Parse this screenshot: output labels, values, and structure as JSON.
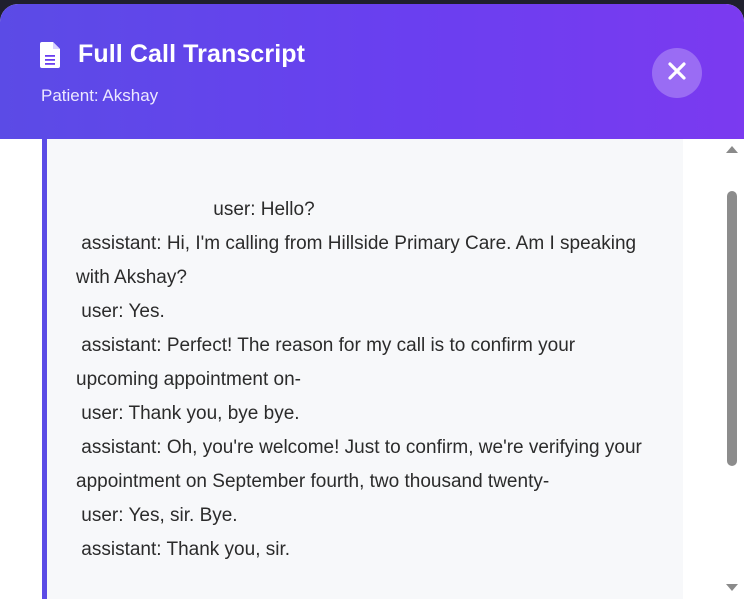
{
  "modal": {
    "title": "Full Call Transcript",
    "subtitle": "Patient: Akshay",
    "title_icon": "document-icon",
    "close_icon": "close-icon",
    "accent_color": "#5b4be6"
  },
  "transcript": {
    "text": "                          user: Hello?\n assistant: Hi, I'm calling from Hillside Primary Care. Am I speaking with Akshay?\n user: Yes.\n assistant: Perfect! The reason for my call is to confirm your upcoming appointment on-\n user: Thank you, bye bye.\n assistant: Oh, you're welcome! Just to confirm, we're verifying your appointment on September fourth, two thousand twenty-\n user: Yes, sir. Bye.\n assistant: Thank you, sir."
  }
}
